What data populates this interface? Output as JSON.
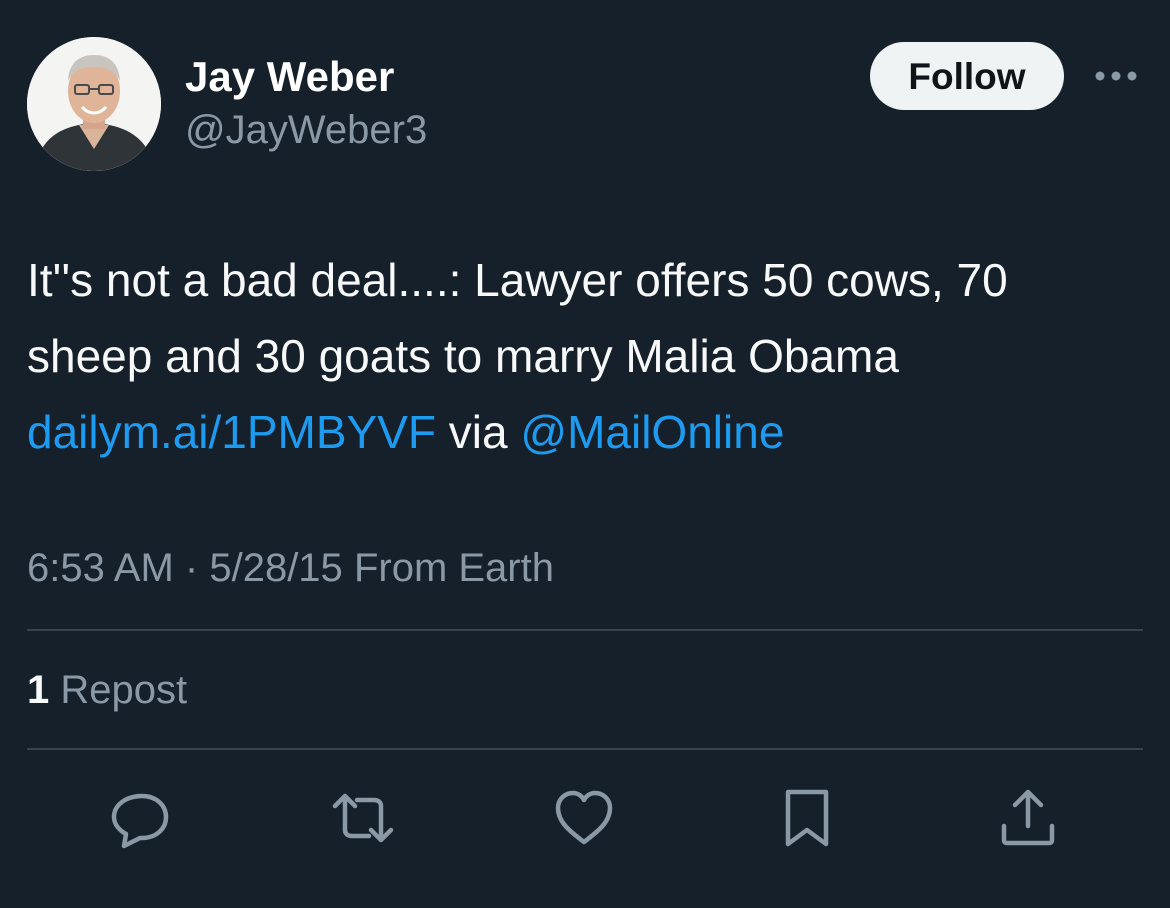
{
  "author": {
    "display_name": "Jay Weber",
    "handle": "@JayWeber3"
  },
  "header": {
    "follow_label": "Follow",
    "more_icon": "more-horizontal-icon"
  },
  "tweet": {
    "line1": "It''s not a bad deal....: Lawyer offers 50 cows, 70",
    "line2": "sheep and 30 goats to marry Malia Obama",
    "link": "dailym.ai/1PMBYVF",
    "via": "via",
    "mention": "@MailOnline"
  },
  "meta": {
    "time": "6:53 AM",
    "separator": "·",
    "date": "5/28/15",
    "source": "From Earth"
  },
  "stats": {
    "repost_count": "1",
    "repost_label": "Repost"
  },
  "actions": {
    "reply": "reply-icon",
    "repost": "repost-icon",
    "like": "like-icon",
    "bookmark": "bookmark-icon",
    "share": "share-icon"
  },
  "colors": {
    "background": "#15202b",
    "text": "#f7f9f9",
    "secondary_text": "#8b98a5",
    "link": "#1d9bf0",
    "divider": "#38444d",
    "follow_button_bg": "#eff3f4"
  }
}
